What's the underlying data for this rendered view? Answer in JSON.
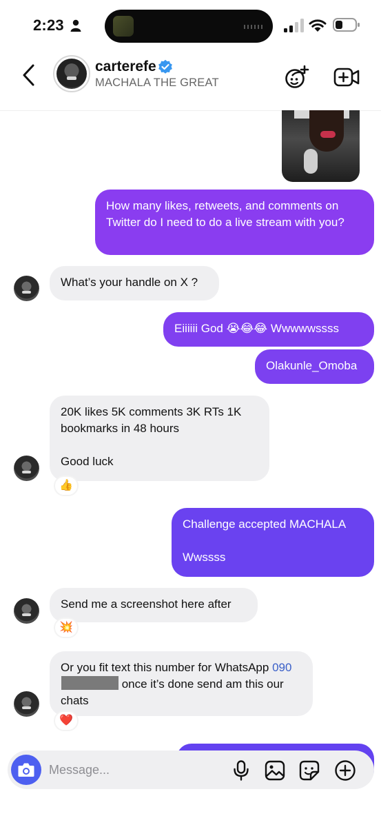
{
  "status_bar": {
    "time": "2:23",
    "icons": [
      "person-icon",
      "signal-icon",
      "wifi-icon",
      "battery-icon"
    ]
  },
  "header": {
    "username": "carterefe",
    "subtitle": "MACHALA THE GREAT",
    "verified": true,
    "icons": [
      "back-icon",
      "effects-icon",
      "video-call-icon"
    ],
    "accent": "#3897f0"
  },
  "messages": [
    {
      "side": "out",
      "text": "How many likes, retweets, and comments on Twitter do I need to do a live stream with you?"
    },
    {
      "side": "in",
      "text": "What’s your handle on X ?"
    },
    {
      "side": "out",
      "text": "Eiiiiii God 😭😂😂 Wwwwwssss"
    },
    {
      "side": "out",
      "text": "Olakunle_Omoba"
    },
    {
      "side": "in",
      "text_1": "20K likes 5K comments 3K RTs 1K bookmarks in 48 hours",
      "text_2": "Good luck",
      "reaction": "👍"
    },
    {
      "side": "out",
      "text_1": "Challenge accepted MACHALA",
      "text_2": "Wwssss"
    },
    {
      "side": "in",
      "text": "Send me a screenshot here after",
      "reaction": "💥"
    },
    {
      "side": "in",
      "text_before": "Or you fit text this number for WhatsApp ",
      "phone_prefix": "090",
      "text_after": " once it’s done send am this our chats",
      "reaction": "❤️"
    }
  ],
  "composer": {
    "placeholder": "Message...",
    "icons": [
      "camera-icon",
      "microphone-icon",
      "gallery-icon",
      "sticker-icon",
      "add-icon"
    ]
  },
  "colors": {
    "outgoing_purple": "#8a3df0",
    "outgoing_violet": "#6342f0",
    "incoming_bg": "#efeff1",
    "camera_button": "#4d5ff0"
  }
}
